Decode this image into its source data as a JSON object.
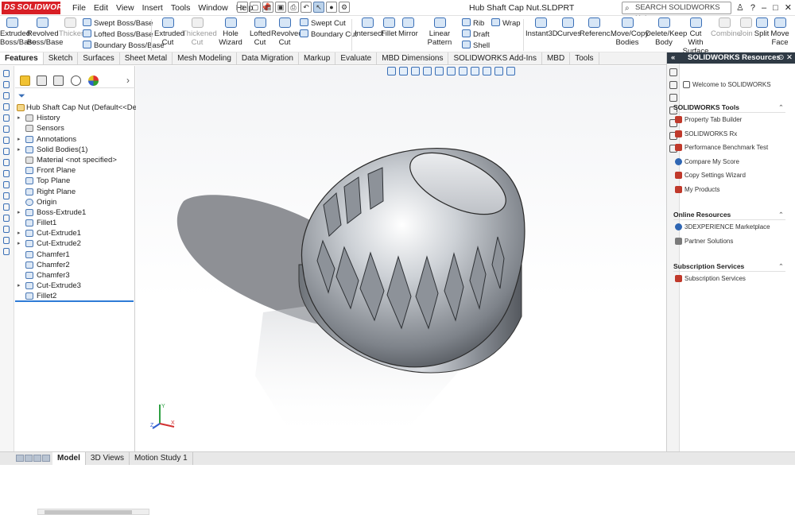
{
  "app": {
    "brand": "SOLIDWORKS",
    "brand_mark": "DS",
    "doc_title": "Hub Shaft Cap Nut.SLDPRT"
  },
  "menu": [
    "File",
    "Edit",
    "View",
    "Insert",
    "Tools",
    "Window",
    "Help"
  ],
  "search": {
    "placeholder": "SEARCH SOLIDWORKS Help"
  },
  "window_controls": {
    "minimize": "–",
    "restore": "□",
    "close": "✕",
    "user": "♙",
    "help": "?"
  },
  "ribbon": {
    "extruded_boss": [
      "Extruded",
      "Boss/Base"
    ],
    "revolved_boss": [
      "Revolved",
      "Boss/Base"
    ],
    "thicken": "Thicken",
    "swept_boss": "Swept Boss/Base",
    "lofted_boss": "Lofted Boss/Base",
    "boundary_boss": "Boundary Boss/Base",
    "extruded_cut": [
      "Extruded",
      "Cut"
    ],
    "thickened_cut": [
      "Thickened",
      "Cut"
    ],
    "hole_wizard": "Hole Wizard",
    "lofted_cut": [
      "Lofted",
      "Cut"
    ],
    "revolved_cut": [
      "Revolved",
      "Cut"
    ],
    "swept_cut": "Swept Cut",
    "boundary_cut": "Boundary Cut",
    "intersect": "Intersect",
    "fillet": "Fillet",
    "mirror": "Mirror",
    "linear_pattern": "Linear Pattern",
    "rib": "Rib",
    "draft": "Draft",
    "shell": "Shell",
    "wrap": "Wrap",
    "instant3d": "Instant3D",
    "curves": "Curves",
    "reference": "Referenc...",
    "move_copy": [
      "Move/Copy",
      "Bodies"
    ],
    "delete_keep": [
      "Delete/Keep",
      "Body"
    ],
    "cut_with_surface": [
      "Cut With",
      "Surface"
    ],
    "combine": "Combine",
    "join": "Join",
    "split": "Split",
    "move_face": [
      "Move",
      "Face"
    ]
  },
  "command_tabs": [
    "Features",
    "Sketch",
    "Surfaces",
    "Sheet Metal",
    "Mesh Modeling",
    "Data Migration",
    "Markup",
    "Evaluate",
    "MBD Dimensions",
    "SOLIDWORKS Add-Ins",
    "MBD",
    "Tools"
  ],
  "command_tab_active": "Features",
  "feature_tree": [
    {
      "label": "Hub Shaft Cap Nut  (Default<<Defau",
      "icon": "part-icon",
      "expand": "",
      "root": true
    },
    {
      "label": "History",
      "icon": "history-icon",
      "expand": "▸"
    },
    {
      "label": "Sensors",
      "icon": "sensor-icon",
      "expand": ""
    },
    {
      "label": "Annotations",
      "icon": "annotations-icon",
      "expand": "▸"
    },
    {
      "label": "Solid Bodies(1)",
      "icon": "solid-bodies-icon",
      "expand": "▸"
    },
    {
      "label": "Material <not specified>",
      "icon": "material-icon",
      "expand": ""
    },
    {
      "label": "Front Plane",
      "icon": "plane-icon",
      "expand": ""
    },
    {
      "label": "Top Plane",
      "icon": "plane-icon",
      "expand": ""
    },
    {
      "label": "Right Plane",
      "icon": "plane-icon",
      "expand": ""
    },
    {
      "label": "Origin",
      "icon": "origin-icon",
      "expand": ""
    },
    {
      "label": "Boss-Extrude1",
      "icon": "boss-extrude-icon",
      "expand": "▸"
    },
    {
      "label": "Fillet1",
      "icon": "fillet-icon",
      "expand": ""
    },
    {
      "label": "Cut-Extrude1",
      "icon": "cut-extrude-icon",
      "expand": "▸"
    },
    {
      "label": "Cut-Extrude2",
      "icon": "cut-extrude-icon",
      "expand": "▸"
    },
    {
      "label": "Chamfer1",
      "icon": "chamfer-icon",
      "expand": ""
    },
    {
      "label": "Chamfer2",
      "icon": "chamfer-icon",
      "expand": ""
    },
    {
      "label": "Chamfer3",
      "icon": "chamfer-icon",
      "expand": ""
    },
    {
      "label": "Cut-Extrude3",
      "icon": "cut-extrude-icon",
      "expand": "▸"
    },
    {
      "label": "Fillet2",
      "icon": "fillet-icon",
      "expand": ""
    }
  ],
  "resources": {
    "title": "SOLIDWORKS Resources",
    "welcome": "Welcome to SOLIDWORKS",
    "sections": [
      {
        "title": "SOLIDWORKS Tools",
        "items": [
          "Property Tab Builder",
          "SOLIDWORKS Rx",
          "Performance Benchmark Test",
          "Compare My Score",
          "Copy Settings Wizard",
          "My Products"
        ]
      },
      {
        "title": "Online Resources",
        "items": [
          "3DEXPERIENCE Marketplace",
          "Partner Solutions"
        ]
      },
      {
        "title": "Subscription Services",
        "items": [
          "Subscription Services"
        ]
      }
    ]
  },
  "bottom_tabs": [
    "Model",
    "3D Views",
    "Motion Study 1"
  ],
  "bottom_tab_active": "Model",
  "colors": {
    "brand_red": "#d81f26",
    "accent_blue": "#2e7bd6",
    "panel_header": "#2f3a45"
  }
}
